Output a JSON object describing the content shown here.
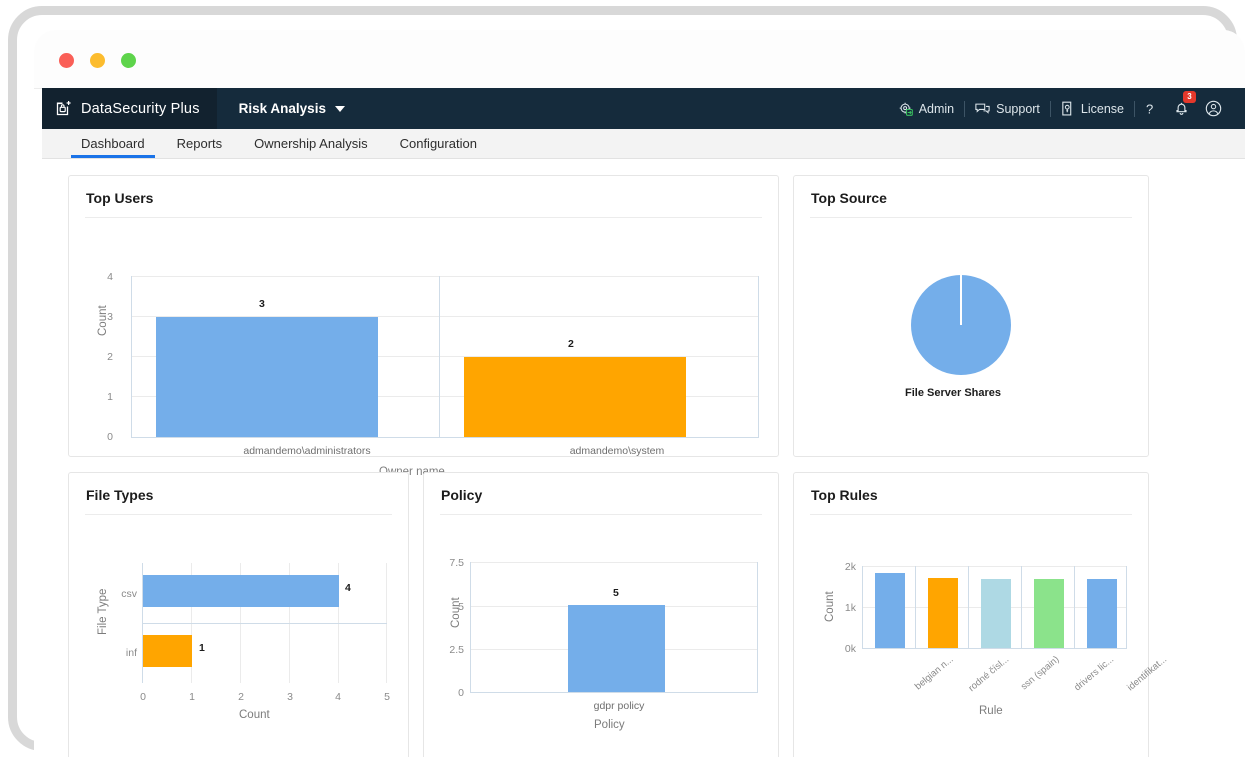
{
  "window": {
    "traffic_lights": [
      "close",
      "minimize",
      "maximize"
    ]
  },
  "navbar": {
    "brand": "DataSecurity Plus",
    "brand_icon": "shield-lock-icon",
    "module": "Risk Analysis",
    "module_caret_icon": "chevron-down-icon",
    "right_items": [
      {
        "label": "Admin",
        "icon": "gear-admin-icon"
      },
      {
        "label": "Support",
        "icon": "chat-support-icon"
      },
      {
        "label": "License",
        "icon": "license-key-icon"
      }
    ],
    "help_icon": "question-mark-icon",
    "notifications_icon": "bell-icon",
    "notifications_count": "3",
    "avatar_icon": "user-avatar-icon",
    "bg_color": "#152b3c",
    "badge_color": "#e5382b"
  },
  "tabs": [
    {
      "label": "Dashboard",
      "active": true
    },
    {
      "label": "Reports",
      "active": false
    },
    {
      "label": "Ownership Analysis",
      "active": false
    },
    {
      "label": "Configuration",
      "active": false
    }
  ],
  "active_tab_indicator_color": "#1a73e8",
  "palette": {
    "blue": "#74aeea",
    "orange": "#ffa500",
    "light_blue": "#aed9e4",
    "green": "#8be38b",
    "blue2": "#74aeea"
  },
  "cards": [
    {
      "title": "Top Users"
    },
    {
      "title": "Top Source"
    },
    {
      "title": "File Types"
    },
    {
      "title": "Policy"
    },
    {
      "title": "Top Rules"
    }
  ],
  "chart_data": [
    {
      "id": "top_users",
      "type": "bar",
      "title": "Top Users",
      "orientation": "vertical",
      "categories": [
        "admandemo\\administrators",
        "admandemo\\system"
      ],
      "values": [
        3,
        2
      ],
      "colors": [
        "#74aeea",
        "#ffa500"
      ],
      "xlabel": "Owner name",
      "ylabel": "Count",
      "ylim": [
        0,
        4
      ],
      "yticks": [
        "0",
        "1",
        "2",
        "3",
        "4"
      ],
      "grid": true
    },
    {
      "id": "top_source",
      "type": "pie",
      "title": "Top Source",
      "slices": [
        {
          "label": "File Server Shares",
          "value": 100,
          "color": "#74aeea"
        }
      ],
      "legend": "none"
    },
    {
      "id": "file_types",
      "type": "bar",
      "title": "File Types",
      "orientation": "horizontal",
      "categories": [
        "csv",
        "inf"
      ],
      "values": [
        4,
        1
      ],
      "colors": [
        "#74aeea",
        "#ffa500"
      ],
      "xlabel": "Count",
      "ylabel": "File Type",
      "xlim": [
        0,
        5
      ],
      "xticks": [
        "0",
        "1",
        "2",
        "3",
        "4",
        "5"
      ],
      "grid": true
    },
    {
      "id": "policy",
      "type": "bar",
      "title": "Policy",
      "orientation": "vertical",
      "categories": [
        "gdpr policy"
      ],
      "values": [
        5
      ],
      "colors": [
        "#74aeea"
      ],
      "xlabel": "Policy",
      "ylabel": "Count",
      "ylim": [
        0,
        7.5
      ],
      "yticks": [
        "0",
        "2.5",
        "5",
        "7.5"
      ],
      "grid": true
    },
    {
      "id": "top_rules",
      "type": "bar",
      "title": "Top Rules",
      "orientation": "vertical",
      "categories": [
        "belgian n...",
        "rodné čísl...",
        "ssn (spain)",
        "drivers lic...",
        "identifikat..."
      ],
      "values": [
        1800,
        1700,
        1680,
        1680,
        1690
      ],
      "colors": [
        "#74aeea",
        "#ffa500",
        "#aed9e4",
        "#8be38b",
        "#74aeea"
      ],
      "xlabel": "Rule",
      "ylabel": "Count",
      "ylim": [
        0,
        2000
      ],
      "yticks": [
        "0k",
        "1k",
        "2k"
      ],
      "grid": true
    }
  ]
}
